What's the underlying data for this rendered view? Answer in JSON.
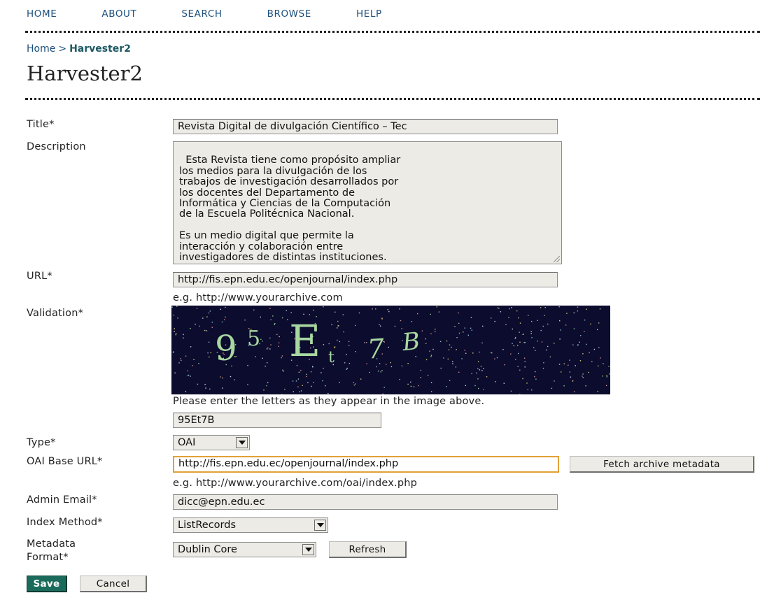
{
  "nav": [
    {
      "label": "HOME"
    },
    {
      "label": "ABOUT"
    },
    {
      "label": "SEARCH"
    },
    {
      "label": "BROWSE"
    },
    {
      "label": "HELP"
    }
  ],
  "breadcrumb": {
    "home": "Home",
    "separator": ">",
    "current": "Harvester2"
  },
  "page_title": "Harvester2",
  "form": {
    "title": {
      "label": "Title*",
      "value": "Revista Digital de divulgación Científico – Tec"
    },
    "description": {
      "label": "Description",
      "value": "Esta Revista tiene como propósito ampliar\nlos medios para la divulgación de los\ntrabajos de investigación desarrollados por\nlos docentes del Departamento de\nInformática y Ciencias de la Computación\nde la Escuela Politécnica Nacional.\n\nEs un medio digital que permite la\ninteracción y colaboración entre\ninvestigadores de distintas instituciones."
    },
    "url": {
      "label": "URL*",
      "value": "http://fis.epn.edu.ec/openjournal/index.php",
      "hint": "e.g. http://www.yourarchive.com"
    },
    "validation": {
      "label": "Validation*",
      "captcha_text": "95Et7B",
      "hint": "Please enter the letters as they appear in the image above.",
      "value": "95Et7B"
    },
    "type": {
      "label": "Type*",
      "value": "OAI"
    },
    "oai_base_url": {
      "label": "OAI Base URL*",
      "value": "http://fis.epn.edu.ec/openjournal/index.php",
      "fetch_button": "Fetch archive metadata",
      "hint": "e.g. http://www.yourarchive.com/oai/index.php"
    },
    "admin_email": {
      "label": "Admin Email*",
      "value": "dicc@epn.edu.ec"
    },
    "index_method": {
      "label": "Index Method*",
      "value": "ListRecords"
    },
    "metadata_format": {
      "label_line1": "Metadata",
      "label_line2": "Format*",
      "value": "Dublin Core",
      "refresh_button": "Refresh"
    }
  },
  "actions": {
    "save": "Save",
    "cancel": "Cancel"
  },
  "colors": {
    "link": "#1d4f7c",
    "breadcrumb_current": "#1e5a63",
    "save_button": "#1b6b5c",
    "focus_border": "#e1a136",
    "captcha_bg": "#0c0c2e",
    "captcha_text": "#a8d8a0"
  }
}
